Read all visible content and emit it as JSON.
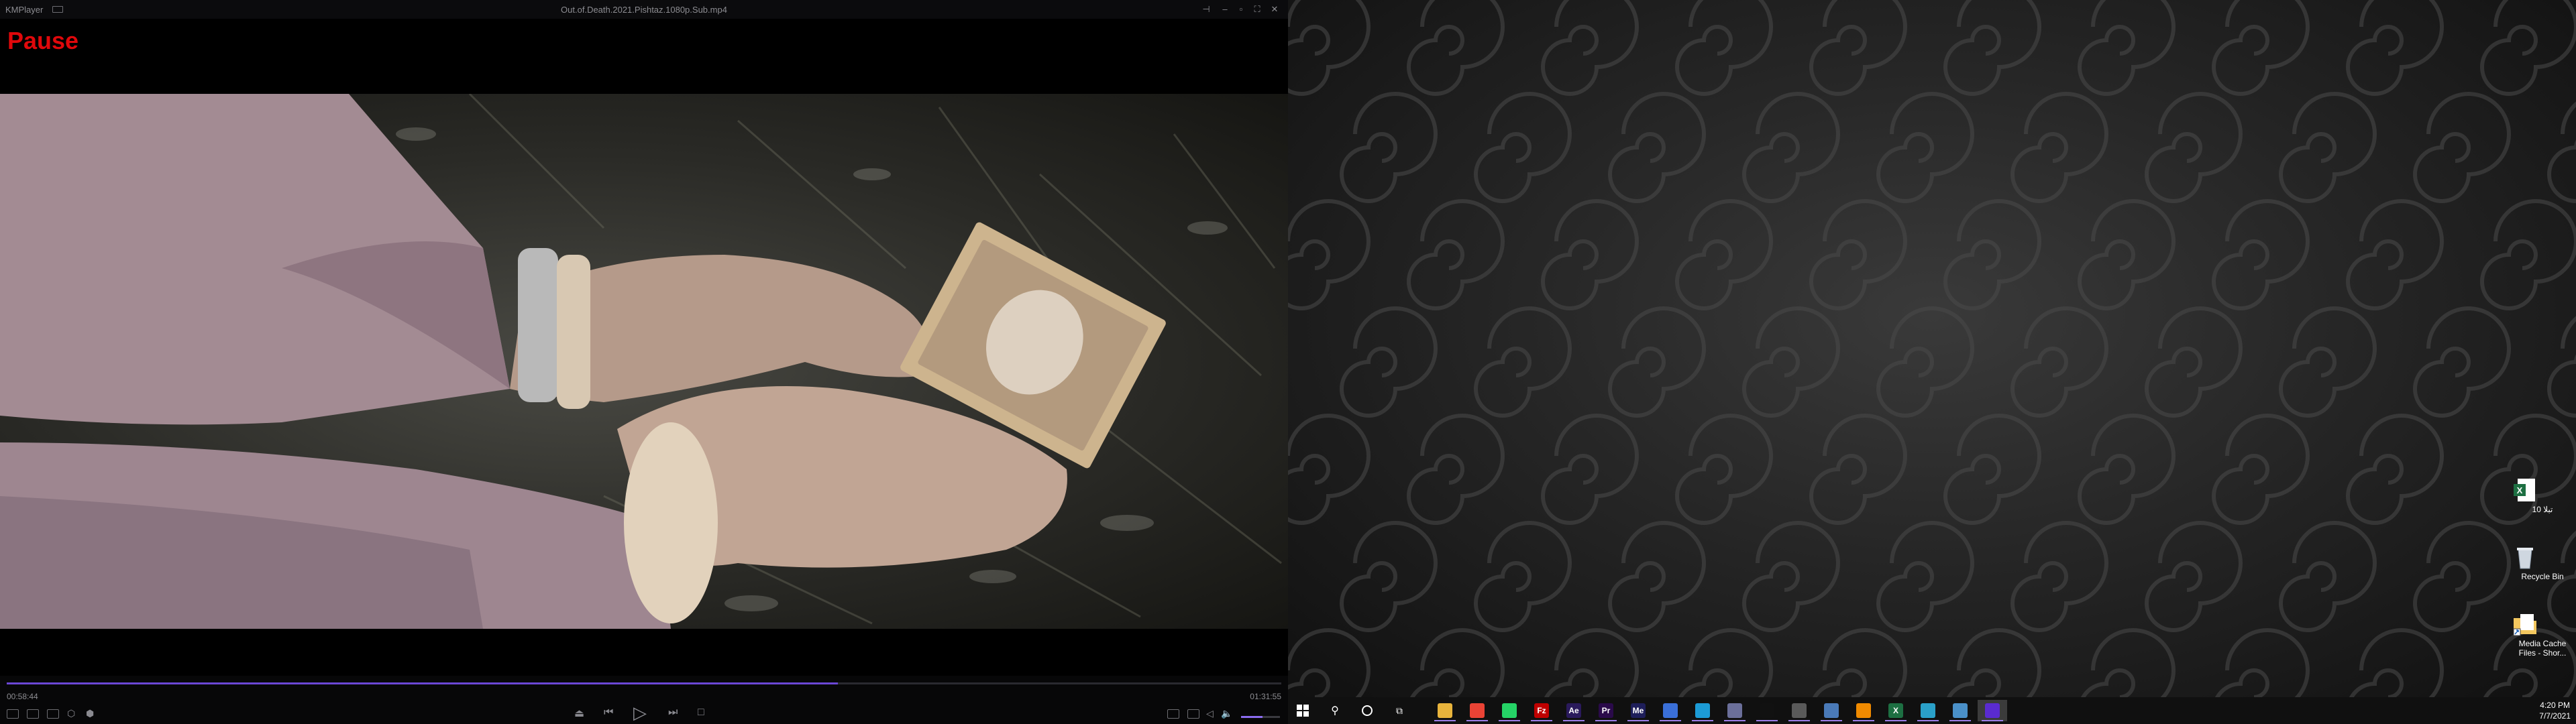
{
  "player": {
    "app_name": "KMPlayer",
    "file_name": "Out.of.Death.2021.Pishtaz.1080p.Sub.mp4",
    "osd_status": "Pause",
    "time_elapsed": "00:58:44",
    "time_total": "01:31:55",
    "playback_progress": 0.652,
    "volume_level": 0.55,
    "accent_color": "#6b47d6",
    "osd_color": "#e0080b"
  },
  "desktop": {
    "icons": [
      {
        "label": "تبلا 10",
        "icon": "excel-file-icon"
      },
      {
        "label": "Recycle Bin",
        "icon": "recycle-bin-icon"
      },
      {
        "label": "Media Cache Files - Shor...",
        "icon": "folder-shortcut-icon"
      }
    ]
  },
  "taskbar": {
    "apps": [
      {
        "name": "file-explorer",
        "glyph": "",
        "color": "#e8b43c"
      },
      {
        "name": "chrome",
        "glyph": "",
        "color": "#ea4335"
      },
      {
        "name": "whatsapp",
        "glyph": "",
        "color": "#25d366"
      },
      {
        "name": "filezilla",
        "glyph": "Fz",
        "color": "#bf0000"
      },
      {
        "name": "after-effects",
        "glyph": "Ae",
        "color": "#2a1a5c"
      },
      {
        "name": "premiere",
        "glyph": "Pr",
        "color": "#2a0a4a"
      },
      {
        "name": "media-encoder",
        "glyph": "Me",
        "color": "#1e1e5a"
      },
      {
        "name": "app-blue",
        "glyph": "",
        "color": "#3a6fd8"
      },
      {
        "name": "edge",
        "glyph": "",
        "color": "#1c9bd6"
      },
      {
        "name": "app-gray",
        "glyph": "",
        "color": "#6b6f9a"
      },
      {
        "name": "app-dark",
        "glyph": "",
        "color": "#111111"
      },
      {
        "name": "app-screen",
        "glyph": "",
        "color": "#5a5a5a"
      },
      {
        "name": "app-wave",
        "glyph": "",
        "color": "#4a7ab8"
      },
      {
        "name": "vlc",
        "glyph": "",
        "color": "#f08a00"
      },
      {
        "name": "excel",
        "glyph": "X",
        "color": "#1d6f42"
      },
      {
        "name": "app-globe",
        "glyph": "",
        "color": "#2aa0c8"
      },
      {
        "name": "app-cloud",
        "glyph": "",
        "color": "#4a90c8"
      },
      {
        "name": "kmplayer",
        "glyph": "",
        "color": "#5a2bd0"
      }
    ],
    "clock_time": "4:20 PM",
    "clock_date": "7/7/2021"
  }
}
